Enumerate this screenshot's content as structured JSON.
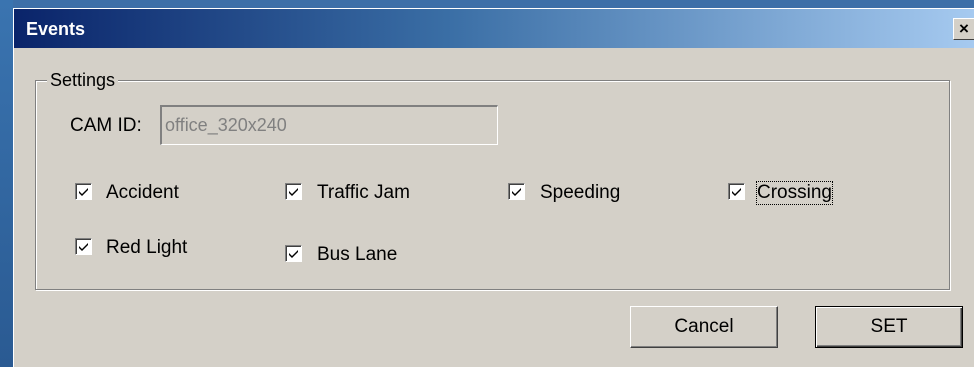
{
  "window": {
    "title": "Events",
    "close_glyph": "×"
  },
  "settings": {
    "group_label": "Settings",
    "cam_id_label": "CAM ID:",
    "cam_id_value": "office_320x240"
  },
  "checkboxes": [
    {
      "label": "Accident",
      "checked": true
    },
    {
      "label": "Traffic Jam",
      "checked": true
    },
    {
      "label": "Speeding",
      "checked": true
    },
    {
      "label": "Crossing",
      "checked": true,
      "focused": true
    },
    {
      "label": "Red Light",
      "checked": true
    },
    {
      "label": "Bus Lane",
      "checked": true
    }
  ],
  "buttons": {
    "cancel": "Cancel",
    "set": "SET"
  },
  "colors": {
    "titlebar_start": "#0a246a",
    "titlebar_end": "#a6caf0",
    "dialog_face": "#d4d0c8",
    "disabled_text": "#808080"
  },
  "icons": {
    "close": "close-icon",
    "check": "checkmark-icon"
  }
}
